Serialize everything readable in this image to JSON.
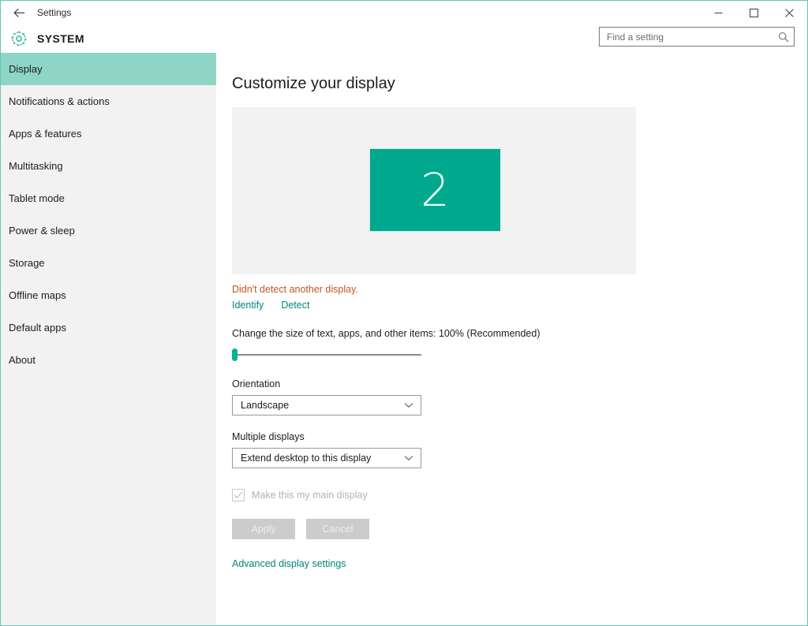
{
  "titlebar": {
    "back_icon": "arrow-left-icon",
    "title": "Settings",
    "minimize_label": "─",
    "maximize_label": "☐",
    "close_label": "✕"
  },
  "header": {
    "gear_icon": "gear-icon",
    "app_title": "SYSTEM",
    "search": {
      "placeholder": "Find a setting",
      "value": "",
      "icon": "search-icon"
    }
  },
  "sidebar": {
    "items": [
      {
        "label": "Display",
        "selected": true
      },
      {
        "label": "Notifications & actions",
        "selected": false
      },
      {
        "label": "Apps & features",
        "selected": false
      },
      {
        "label": "Multitasking",
        "selected": false
      },
      {
        "label": "Tablet mode",
        "selected": false
      },
      {
        "label": "Power & sleep",
        "selected": false
      },
      {
        "label": "Storage",
        "selected": false
      },
      {
        "label": "Offline maps",
        "selected": false
      },
      {
        "label": "Default apps",
        "selected": false
      },
      {
        "label": "About",
        "selected": false
      }
    ]
  },
  "main": {
    "page_title": "Customize your display",
    "preview": {
      "monitor_number": "2",
      "monitor_color": "#00a88e",
      "background_color": "#f2f2f2"
    },
    "detect_message": "Didn't detect another display.",
    "detect_message_color": "#c4551f",
    "identify_link": "Identify",
    "detect_link": "Detect",
    "link_color": "#00857a",
    "scale": {
      "label": "Change the size of text, apps, and other items: 100% (Recommended)",
      "value": "100%",
      "position_percent": 0
    },
    "orientation": {
      "label": "Orientation",
      "value": "Landscape",
      "chevron_icon": "chevron-down-icon"
    },
    "multiple_displays": {
      "label": "Multiple displays",
      "value": "Extend desktop to this display",
      "chevron_icon": "chevron-down-icon"
    },
    "main_display_checkbox": {
      "label": "Make this my main display",
      "checked": true,
      "disabled": true,
      "check_icon": "checkmark-icon"
    },
    "apply_button": "Apply",
    "cancel_button": "Cancel",
    "advanced_link": "Advanced display settings"
  }
}
